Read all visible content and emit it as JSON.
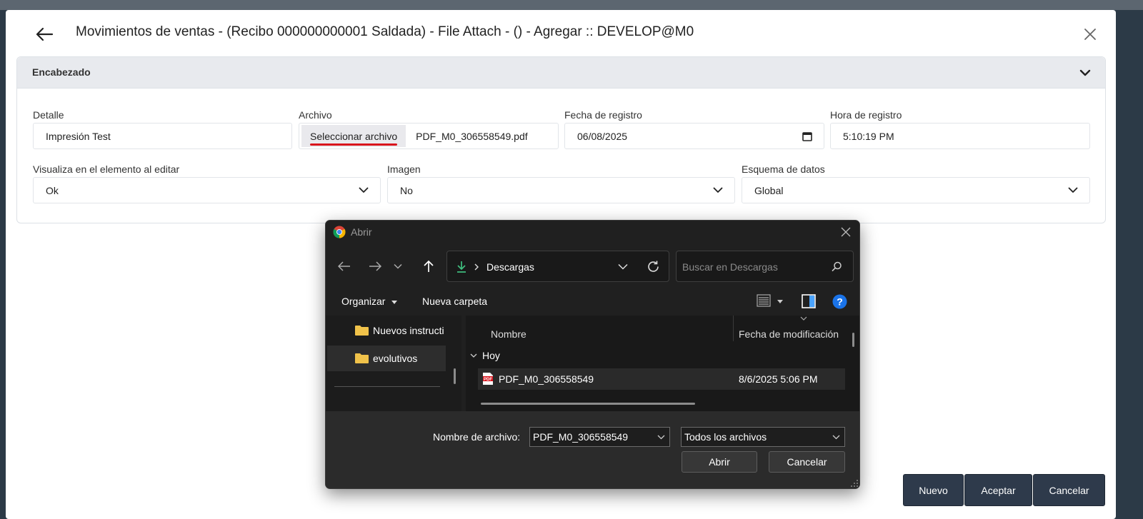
{
  "modal": {
    "title": "Movimientos de ventas - (Recibo 000000000001 Saldada) - File Attach - () - Agregar :: DEVELOP@M0",
    "section_title": "Encabezado",
    "fields": {
      "detalle": {
        "label": "Detalle",
        "value": "Impresión Test"
      },
      "archivo": {
        "label": "Archivo",
        "button_label": "Seleccionar archivo",
        "file_name": "PDF_M0_306558549.pdf"
      },
      "fecha": {
        "label": "Fecha de registro",
        "value": "06/08/2025"
      },
      "hora": {
        "label": "Hora de registro",
        "value": "5:10:19 PM"
      },
      "visualiza": {
        "label": "Visualiza en el elemento al editar",
        "value": "Ok"
      },
      "imagen": {
        "label": "Imagen",
        "value": "No"
      },
      "esquema": {
        "label": "Esquema de datos",
        "value": "Global"
      }
    },
    "actions": {
      "nuevo": "Nuevo",
      "aceptar": "Aceptar",
      "cancelar": "Cancelar"
    }
  },
  "dialog": {
    "title": "Abrir",
    "address": "Descargas",
    "search_placeholder": "Buscar en Descargas",
    "toolbar": {
      "organize": "Organizar",
      "new_folder": "Nueva carpeta"
    },
    "nav_items": [
      {
        "label": "Nuevos instructi"
      },
      {
        "label": "evolutivos"
      }
    ],
    "columns": {
      "name": "Nombre",
      "modified": "Fecha de modificación"
    },
    "group": "Hoy",
    "files": [
      {
        "name": "PDF_M0_306558549",
        "modified": "8/6/2025 5:06 PM"
      }
    ],
    "filename_label": "Nombre de archivo:",
    "filename_value": "PDF_M0_306558549",
    "filetype_value": "Todos los archivos",
    "open_label": "Abrir",
    "cancel_label": "Cancelar"
  },
  "colors": {
    "accent_dark": "#2e3a4b",
    "underline_red": "#d9131c",
    "dialog_bg": "#202020",
    "help_blue": "#1a73e8",
    "download_green": "#3fbf7f",
    "folder_yellow": "#f0c24a"
  },
  "icons": [
    "back-arrow-icon",
    "close-icon",
    "chevron-down-icon",
    "calendar-icon",
    "chrome-icon",
    "folder-icon",
    "pdf-icon",
    "search-icon",
    "refresh-icon",
    "help-icon"
  ]
}
